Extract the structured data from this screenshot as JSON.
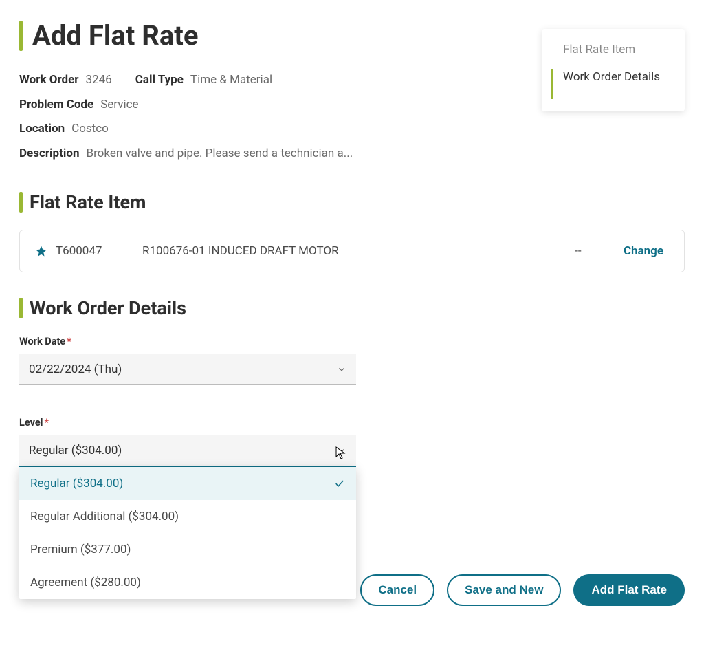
{
  "page": {
    "title": "Add Flat Rate"
  },
  "meta": {
    "work_order_label": "Work Order",
    "work_order_value": "3246",
    "call_type_label": "Call Type",
    "call_type_value": "Time & Material",
    "problem_code_label": "Problem Code",
    "problem_code_value": "Service",
    "location_label": "Location",
    "location_value": "Costco",
    "description_label": "Description",
    "description_value": "Broken valve and pipe. Please send a technician a..."
  },
  "nav": {
    "item1": "Flat Rate Item",
    "item2": "Work Order Details"
  },
  "sections": {
    "flat_rate_item": "Flat Rate Item",
    "work_order_details": "Work Order Details"
  },
  "item": {
    "code": "T600047",
    "description": "R100676-01 INDUCED DRAFT MOTOR",
    "dash": "--",
    "change": "Change"
  },
  "form": {
    "work_date_label": "Work Date",
    "work_date_value": "02/22/2024 (Thu)",
    "level_label": "Level",
    "level_value": "Regular ($304.00)",
    "level_options": {
      "0": "Regular ($304.00)",
      "1": "Regular Additional ($304.00)",
      "2": "Premium ($377.00)",
      "3": "Agreement ($280.00)"
    }
  },
  "buttons": {
    "cancel": "Cancel",
    "save_new": "Save and New",
    "add_flat_rate": "Add Flat Rate"
  }
}
